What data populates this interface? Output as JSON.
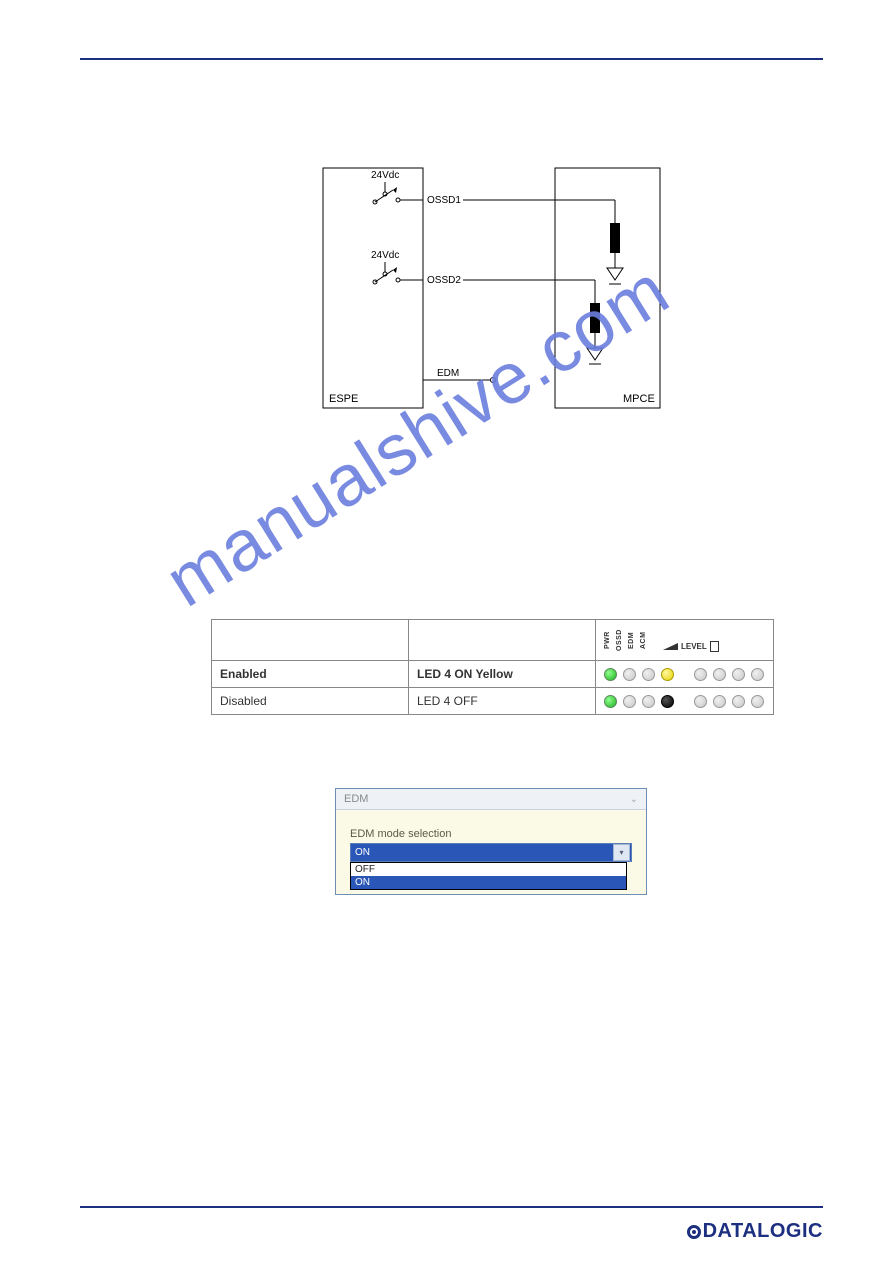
{
  "header": {},
  "diagram": {
    "espe_label": "ESPE",
    "mpce_label": "MPCE",
    "supply1": "24Vdc",
    "supply2": "24Vdc",
    "ossd1": "OSSD1",
    "ossd2": "OSSD2",
    "edm": "EDM"
  },
  "watermark": "manualshive.com",
  "table": {
    "headers": {
      "pwr": "PWR",
      "ossd": "OSSD",
      "edm": "EDM",
      "acm": "ACM",
      "level": "LEVEL"
    },
    "rows": [
      {
        "name": "Enabled",
        "state": "LED 4 ON Yellow",
        "bold": true,
        "leds": [
          "green",
          "off",
          "off",
          "yellow",
          "off",
          "off",
          "off",
          "off"
        ]
      },
      {
        "name": "Disabled",
        "state": "LED 4 OFF",
        "bold": false,
        "leds": [
          "green",
          "off",
          "off",
          "black",
          "off",
          "off",
          "off",
          "off"
        ]
      }
    ]
  },
  "dialog": {
    "title": "EDM",
    "label": "EDM mode selection",
    "selected": "ON",
    "options": [
      "OFF",
      "ON"
    ]
  },
  "footer": {
    "brand": "DATALOGIC"
  }
}
